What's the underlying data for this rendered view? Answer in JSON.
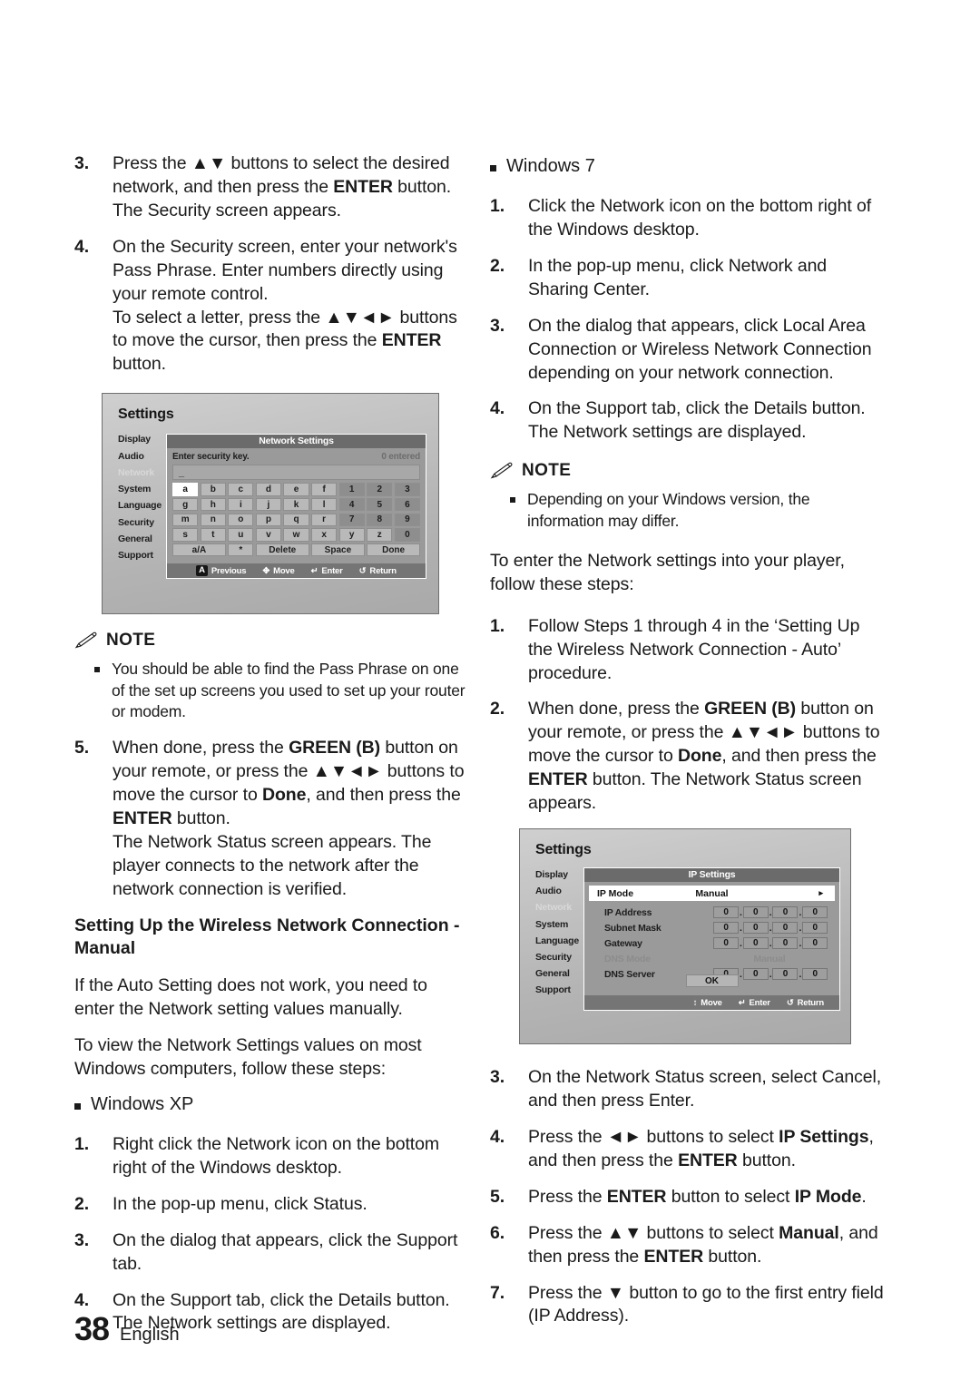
{
  "page": {
    "number": "38",
    "language": "English"
  },
  "left_column": {
    "steps_top": [
      {
        "num": "3.",
        "parts": [
          {
            "t": "Press the "
          },
          {
            "t": "▲▼",
            "b": false
          },
          {
            "t": " buttons to select the desired network, and then press the "
          },
          {
            "t": "ENTER",
            "b": true
          },
          {
            "t": " button. The Security screen appears."
          }
        ]
      },
      {
        "num": "4.",
        "parts": [
          {
            "t": "On the Security screen, enter your network's Pass Phrase. Enter numbers directly using your remote control."
          }
        ],
        "sub_parts": [
          {
            "t": "To select a letter, press the "
          },
          {
            "t": "▲▼◄►",
            "b": false
          },
          {
            "t": " buttons to move the cursor, then press the "
          },
          {
            "t": "ENTER",
            "b": true
          },
          {
            "t": " button."
          }
        ]
      }
    ],
    "note": {
      "label": "NOTE",
      "items": [
        "You should be able to find the Pass Phrase on one of the set up screens you used to set up your router or modem."
      ]
    },
    "step5": {
      "num": "5.",
      "parts": [
        {
          "t": "When done, press the "
        },
        {
          "t": "GREEN (B)",
          "b": true
        },
        {
          "t": " button on your remote, or press the "
        },
        {
          "t": "▲▼◄►",
          "b": false
        },
        {
          "t": " buttons to move the cursor to "
        },
        {
          "t": "Done",
          "b": true
        },
        {
          "t": ", and then press the "
        },
        {
          "t": "ENTER",
          "b": true
        },
        {
          "t": " button."
        }
      ],
      "sub_parts": [
        {
          "t": "The Network Status screen appears. The player connects to the network after the network connection is verified."
        }
      ]
    },
    "section_heading": "Setting Up the Wireless Network Connection - Manual",
    "paragraphs": [
      "If the Auto Setting does not work, you need to enter the Network setting values manually.",
      "To view the Network Settings values on most Windows computers, follow these steps:"
    ],
    "windows_xp_heading": "Windows XP",
    "windows_xp_steps": [
      {
        "num": "1.",
        "text": "Right click the Network icon on the bottom right of the Windows desktop."
      },
      {
        "num": "2.",
        "text": "In the pop-up menu, click Status."
      },
      {
        "num": "3.",
        "text": "On the dialog that appears, click the Support tab."
      },
      {
        "num": "4.",
        "text": "On the Support tab, click the Details button. The Network settings are displayed."
      }
    ]
  },
  "right_column": {
    "windows_7_heading": "Windows 7",
    "windows_7_steps": [
      {
        "num": "1.",
        "text": "Click the Network icon on the bottom right of the Windows desktop."
      },
      {
        "num": "2.",
        "text": "In the pop-up menu, click Network and Sharing Center."
      },
      {
        "num": "3.",
        "text": "On the dialog that appears, click Local Area Connection or Wireless Network Connection depending on your network connection."
      },
      {
        "num": "4.",
        "text": "On the Support tab, click the Details button. The Network settings are displayed."
      }
    ],
    "note": {
      "label": "NOTE",
      "items": [
        "Depending on your Windows version, the information may differ."
      ]
    },
    "intro_paragraph": "To enter the Network settings into your player, follow these steps:",
    "steps_mid": [
      {
        "num": "1.",
        "parts": [
          {
            "t": "Follow Steps 1 through 4 in the ‘Setting Up the Wireless Network Connection - Auto’ procedure."
          }
        ]
      },
      {
        "num": "2.",
        "parts": [
          {
            "t": "When done, press the "
          },
          {
            "t": "GREEN (B)",
            "b": true
          },
          {
            "t": " button on your remote, or press the "
          },
          {
            "t": "▲▼◄►",
            "b": false
          },
          {
            "t": " buttons to move the cursor to "
          },
          {
            "t": "Done",
            "b": true
          },
          {
            "t": ", and then press the "
          },
          {
            "t": "ENTER",
            "b": true
          },
          {
            "t": " button. The Network Status screen appears."
          }
        ]
      }
    ],
    "steps_bottom": [
      {
        "num": "3.",
        "parts": [
          {
            "t": "On the Network Status screen, select Cancel, and then press Enter."
          }
        ]
      },
      {
        "num": "4.",
        "parts": [
          {
            "t": "Press the "
          },
          {
            "t": "◄►",
            "b": false
          },
          {
            "t": " buttons to select "
          },
          {
            "t": "IP Settings",
            "b": true
          },
          {
            "t": ", and then press the "
          },
          {
            "t": "ENTER",
            "b": true
          },
          {
            "t": " button."
          }
        ]
      },
      {
        "num": "5.",
        "parts": [
          {
            "t": "Press the "
          },
          {
            "t": "ENTER",
            "b": true
          },
          {
            "t": " button to select "
          },
          {
            "t": "IP Mode",
            "b": true
          },
          {
            "t": "."
          }
        ]
      },
      {
        "num": "6.",
        "parts": [
          {
            "t": "Press the "
          },
          {
            "t": "▲▼",
            "b": false
          },
          {
            "t": " buttons to select "
          },
          {
            "t": "Manual",
            "b": true
          },
          {
            "t": ", and then press the "
          },
          {
            "t": "ENTER",
            "b": true
          },
          {
            "t": " button."
          }
        ]
      },
      {
        "num": "7.",
        "parts": [
          {
            "t": "Press the "
          },
          {
            "t": "▼",
            "b": false
          },
          {
            "t": " button to go to the first entry field (IP Address)."
          }
        ]
      }
    ]
  },
  "screenshot_network": {
    "title": "Settings",
    "sidebar": [
      {
        "label": "Display",
        "dim": false
      },
      {
        "label": "Audio",
        "dim": false
      },
      {
        "label": "Network",
        "dim": true
      },
      {
        "label": "System",
        "dim": false
      },
      {
        "label": "Language",
        "dim": false
      },
      {
        "label": "Security",
        "dim": false
      },
      {
        "label": "General",
        "dim": false
      },
      {
        "label": "Support",
        "dim": false
      }
    ],
    "panel_title": "Network Settings",
    "prompt": "Enter security key.",
    "counter": "0 entered",
    "input_value": "_",
    "keyboard": [
      [
        {
          "k": "a",
          "t": "sel"
        },
        {
          "k": "b",
          "t": "ltr"
        },
        {
          "k": "c",
          "t": "ltr"
        },
        {
          "k": "d",
          "t": "ltr"
        },
        {
          "k": "e",
          "t": "ltr"
        },
        {
          "k": "f",
          "t": "ltr"
        },
        {
          "k": "1",
          "t": "num"
        },
        {
          "k": "2",
          "t": "num"
        },
        {
          "k": "3",
          "t": "num"
        }
      ],
      [
        {
          "k": "g",
          "t": "ltr"
        },
        {
          "k": "h",
          "t": "ltr"
        },
        {
          "k": "i",
          "t": "ltr"
        },
        {
          "k": "j",
          "t": "ltr"
        },
        {
          "k": "k",
          "t": "ltr"
        },
        {
          "k": "l",
          "t": "ltr"
        },
        {
          "k": "4",
          "t": "num"
        },
        {
          "k": "5",
          "t": "num"
        },
        {
          "k": "6",
          "t": "num"
        }
      ],
      [
        {
          "k": "m",
          "t": "ltr"
        },
        {
          "k": "n",
          "t": "ltr"
        },
        {
          "k": "o",
          "t": "ltr"
        },
        {
          "k": "p",
          "t": "ltr"
        },
        {
          "k": "q",
          "t": "ltr"
        },
        {
          "k": "r",
          "t": "ltr"
        },
        {
          "k": "7",
          "t": "num"
        },
        {
          "k": "8",
          "t": "num"
        },
        {
          "k": "9",
          "t": "num"
        }
      ],
      [
        {
          "k": "s",
          "t": "ltr"
        },
        {
          "k": "t",
          "t": "ltr"
        },
        {
          "k": "u",
          "t": "ltr"
        },
        {
          "k": "v",
          "t": "ltr"
        },
        {
          "k": "w",
          "t": "ltr"
        },
        {
          "k": "x",
          "t": "ltr"
        },
        {
          "k": "y",
          "t": "ltr"
        },
        {
          "k": "z",
          "t": "ltr"
        },
        {
          "k": "0",
          "t": "num"
        }
      ]
    ],
    "keyboard_actions": [
      {
        "label": "a/A",
        "w": 2
      },
      {
        "label": "*",
        "w": 1
      },
      {
        "label": "Delete",
        "w": 2
      },
      {
        "label": "Space",
        "w": 2
      },
      {
        "label": "Done",
        "w": 2
      }
    ],
    "footer_items": [
      {
        "glyph": "A",
        "badge": true,
        "label": "Previous"
      },
      {
        "glyph": "✥",
        "badge": false,
        "label": "Move"
      },
      {
        "glyph": "↵",
        "badge": false,
        "label": "Enter"
      },
      {
        "glyph": "↺",
        "badge": false,
        "label": "Return"
      }
    ]
  },
  "screenshot_ip": {
    "title": "Settings",
    "sidebar": [
      {
        "label": "Display",
        "dim": false
      },
      {
        "label": "Audio",
        "dim": false
      },
      {
        "label": "Network",
        "dim": true
      },
      {
        "label": "System",
        "dim": false
      },
      {
        "label": "Language",
        "dim": false
      },
      {
        "label": "Security",
        "dim": false
      },
      {
        "label": "General",
        "dim": false
      },
      {
        "label": "Support",
        "dim": false
      }
    ],
    "panel_title": "IP Settings",
    "ip_mode": {
      "label": "IP Mode",
      "value": "Manual",
      "arrow": "▸"
    },
    "rows": [
      {
        "label": "IP Address",
        "octets": [
          "0",
          "0",
          "0",
          "0"
        ],
        "dim": false,
        "has_octets": true
      },
      {
        "label": "Subnet Mask",
        "octets": [
          "0",
          "0",
          "0",
          "0"
        ],
        "dim": false,
        "has_octets": true
      },
      {
        "label": "Gateway",
        "octets": [
          "0",
          "0",
          "0",
          "0"
        ],
        "dim": false,
        "has_octets": true
      },
      {
        "label": "DNS Mode",
        "value": "Manual",
        "dim": true,
        "has_octets": false
      },
      {
        "label": "DNS Server",
        "octets": [
          "0",
          "0",
          "0",
          "0"
        ],
        "dim": false,
        "has_octets": true
      }
    ],
    "ok_label": "OK",
    "footer_items": [
      {
        "glyph": "↕",
        "badge": false,
        "label": "Move"
      },
      {
        "glyph": "↵",
        "badge": false,
        "label": "Enter"
      },
      {
        "glyph": "↺",
        "badge": false,
        "label": "Return"
      }
    ]
  }
}
